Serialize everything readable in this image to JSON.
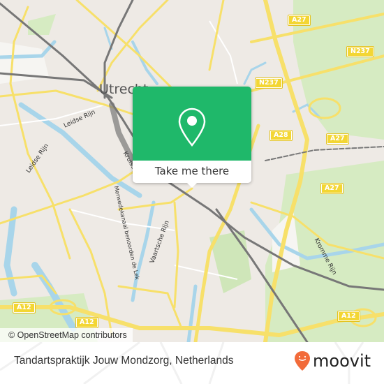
{
  "map": {
    "city_label": "Utrecht",
    "attribution": "© OpenStreetMap contributors",
    "road_labels": [
      "Leidse Rijn",
      "Leidse Rijn",
      "Kruisstraat",
      "Merwedekanaal benoorden de Lek",
      "Vaartsche Rijn",
      "Kromme Rijn"
    ],
    "shields": [
      "A27",
      "N237",
      "N237",
      "A28",
      "A27",
      "A27",
      "A12",
      "A12",
      "A12"
    ],
    "colors": {
      "land": "#eeeae5",
      "water": "#a8d5ea",
      "park": "#d6ebc2",
      "major_road": "#f7e06a",
      "railway": "#777777",
      "shield": "#f3d633"
    }
  },
  "popup": {
    "icon": "map-pin-icon",
    "button_label": "Take me there",
    "color": "#1fb86a"
  },
  "footer": {
    "place_name": "Tandartspraktijk Jouw Mondzorg, Netherlands",
    "brand": "moovit",
    "brand_color": "#f26b3a"
  }
}
